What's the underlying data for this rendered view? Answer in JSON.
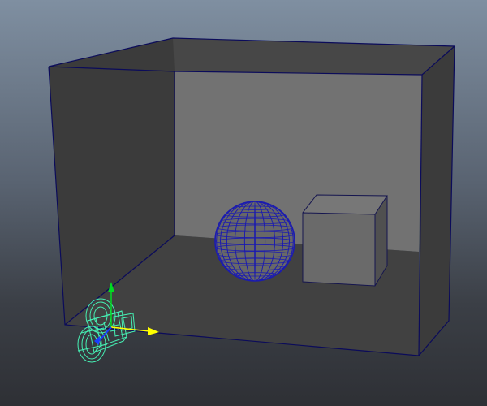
{
  "viewport": {
    "background_top": "#7f8fa1",
    "background_bottom": "#2e3035"
  },
  "scene": {
    "room": {
      "icon": "room-box",
      "wall_color_dark": "#3b3b3b",
      "wall_color_mid": "#474747",
      "back_wall_color": "#727272",
      "floor_color": "#414141",
      "edge_color": "#0b0b5a"
    },
    "sphere": {
      "icon": "wireframe-sphere",
      "fill": "#686868",
      "wire_color": "#1b1bb0"
    },
    "cube": {
      "icon": "cube",
      "fill_front": "#6a6a6a",
      "fill_top": "#777777",
      "fill_side": "#505050"
    },
    "camera": {
      "icon": "camera-gizmo",
      "wire_color": "#46f0b4"
    },
    "manipulator": {
      "x_axis_color": "#ffff00",
      "y_axis_color": "#00dd22",
      "z_axis_color": "#1a3cff"
    }
  }
}
